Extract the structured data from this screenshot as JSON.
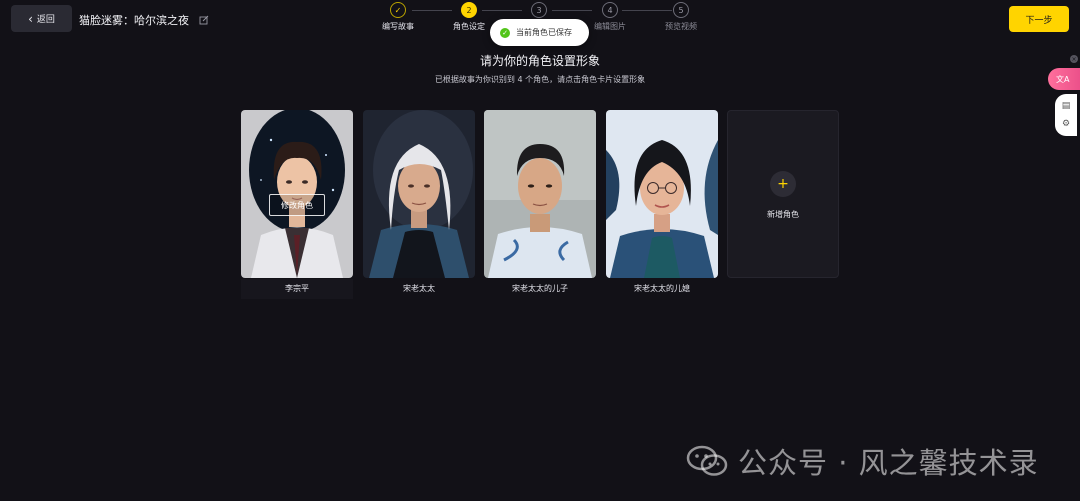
{
  "header": {
    "back_label": "返回",
    "story_title": "猫脸迷雾：哈尔滨之夜",
    "next_label": "下一步"
  },
  "stepper": [
    {
      "num": "✓",
      "label": "编写故事",
      "state": "done"
    },
    {
      "num": "2",
      "label": "角色设定",
      "state": "active"
    },
    {
      "num": "3",
      "label": "",
      "state": "pending"
    },
    {
      "num": "4",
      "label": "编辑图片",
      "state": "pending"
    },
    {
      "num": "5",
      "label": "预览视频",
      "state": "pending"
    }
  ],
  "toast": {
    "text": "当前角色已保存"
  },
  "main": {
    "heading": "请为你的角色设置形象",
    "subheading": "已根据故事为你识别到 4 个角色，请点击角色卡片设置形象"
  },
  "characters": [
    {
      "name": "李宗平",
      "modify_label": "修改角色"
    },
    {
      "name": "宋老太太"
    },
    {
      "name": "宋老太太的儿子"
    },
    {
      "name": "宋老太太的儿媳"
    }
  ],
  "new_character_label": "新增角色",
  "side_tools": {
    "close": "×",
    "translate_icon": "文A"
  },
  "watermark": "公众号 · 风之馨技术录",
  "colors": {
    "accent": "#ffd400",
    "background": "#121117",
    "success": "#52c41a"
  }
}
